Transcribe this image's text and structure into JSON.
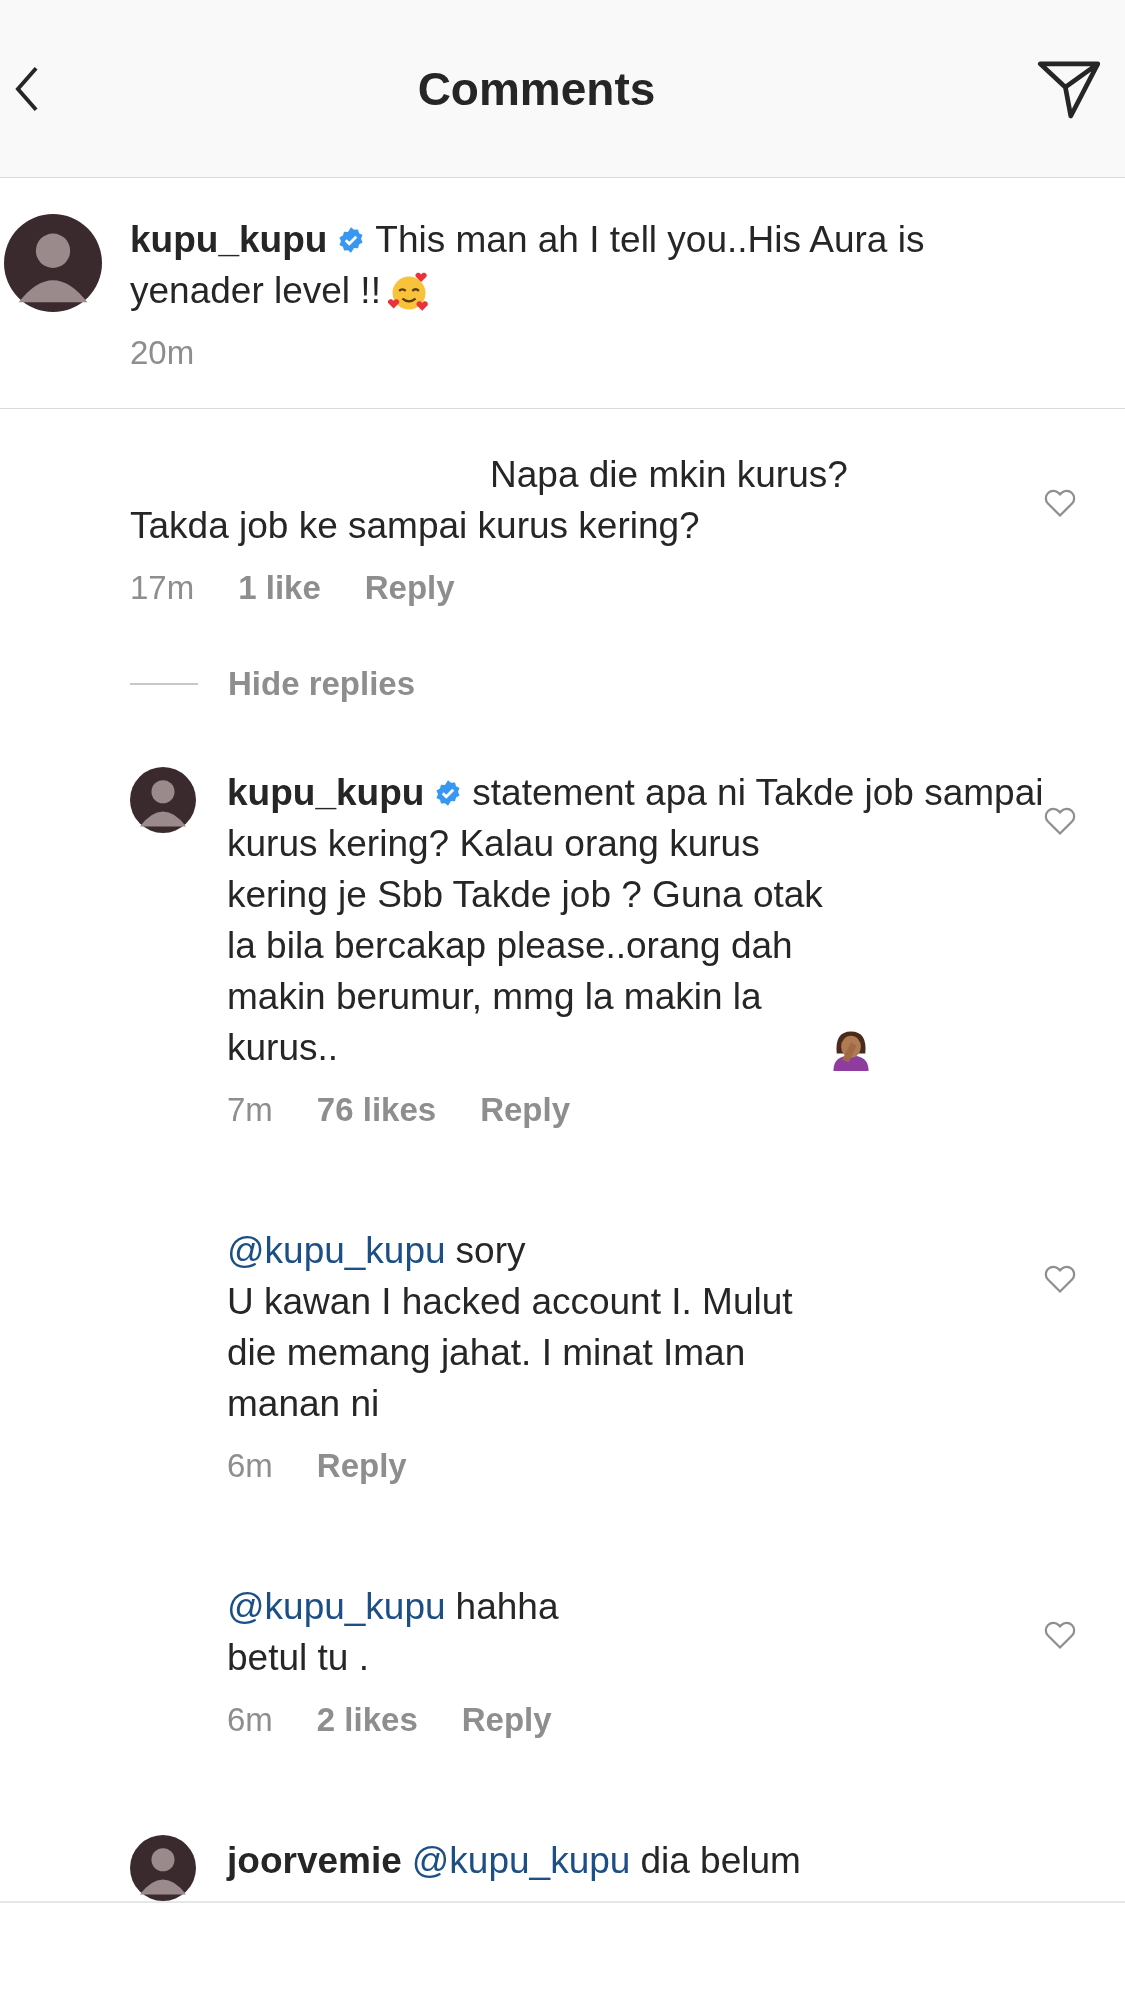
{
  "header": {
    "title": "Comments"
  },
  "caption": {
    "username": "kupu_kupu",
    "verified": true,
    "lines": [
      "This man ah I tell you..His Aura is",
      "yenader level !!"
    ],
    "emoji": {
      "kind": "hearts-face"
    },
    "time": "20m"
  },
  "comments": [
    {
      "kind": "comment",
      "lines": [
        "Napa die mkin kurus?",
        "Takda job ke sampai kurus kering?"
      ],
      "time": "17m",
      "likes": "1 like",
      "reply": "Reply",
      "replies_toggle": "Hide replies"
    },
    {
      "kind": "reply",
      "username": "kupu_kupu",
      "verified": true,
      "lines": [
        "statement apa ni Takde job sampai",
        "kurus kering? Kalau orang kurus",
        "kering je Sbb Takde job ? Guna otak",
        "la bila bercakap please..orang dah",
        "makin berumur, mmg la makin la",
        "kurus.."
      ],
      "emoji": {
        "kind": "facepalm"
      },
      "time": "7m",
      "likes": "76 likes",
      "reply": "Reply"
    },
    {
      "kind": "reply",
      "mention": "@kupu_kupu",
      "lines": [
        "sory",
        "U kawan I hacked account I. Mulut",
        "die memang jahat. I minat Iman",
        "manan ni"
      ],
      "time": "6m",
      "reply": "Reply"
    },
    {
      "kind": "reply",
      "mention": "@kupu_kupu",
      "lines": [
        "hahha",
        "betul tu ."
      ],
      "time": "6m",
      "likes": "2 likes",
      "reply": "Reply"
    },
    {
      "kind": "partial",
      "username": "joorvemie",
      "mention": "@kupu_kupu",
      "lines": [
        "dia belum"
      ]
    }
  ]
}
